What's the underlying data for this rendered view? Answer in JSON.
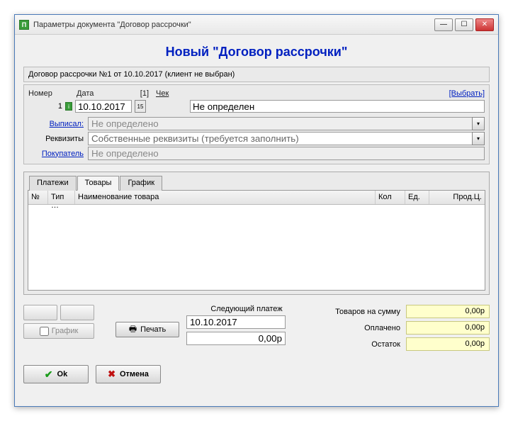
{
  "window": {
    "title": "Параметры документа \"Договор рассрочки\""
  },
  "heading": "Новый \"Договор рассрочки\"",
  "info_line": "Договор рассрочки №1 от 10.10.2017 (клиент не выбран)",
  "header": {
    "number_label": "Номер",
    "date_label": "Дата",
    "count_label": "[1]",
    "check_label": "Чек",
    "select_link": "[Выбрать]",
    "number_value": "1",
    "date_value": "10.10.2017",
    "check_value": "Не определен"
  },
  "form": {
    "issued_label": "Выписал:",
    "issued_value": "Не определено",
    "requisites_label": "Реквизиты",
    "requisites_value": "Собственные реквизиты (требуется заполнить)",
    "buyer_label": "Покупатель",
    "buyer_value": "Не определено"
  },
  "tabs": {
    "t1": "Платежи",
    "t2": "Товары",
    "t3": "График"
  },
  "grid": {
    "col_num": "№",
    "col_type": "Тип …",
    "col_name": "Наименование товара",
    "col_qty": "Кол",
    "col_unit": "Ед.",
    "col_price": "Прод.Ц."
  },
  "footer": {
    "graph_label": "График",
    "print_label": "Печать",
    "next_payment_label": "Следующий платеж",
    "next_payment_date": "10.10.2017",
    "next_payment_amount": "0,00р",
    "goods_sum_label": "Товаров на сумму",
    "goods_sum_value": "0,00р",
    "paid_label": "Оплачено",
    "paid_value": "0,00р",
    "balance_label": "Остаток",
    "balance_value": "0,00р"
  },
  "actions": {
    "ok": "Ok",
    "cancel": "Отмена"
  }
}
